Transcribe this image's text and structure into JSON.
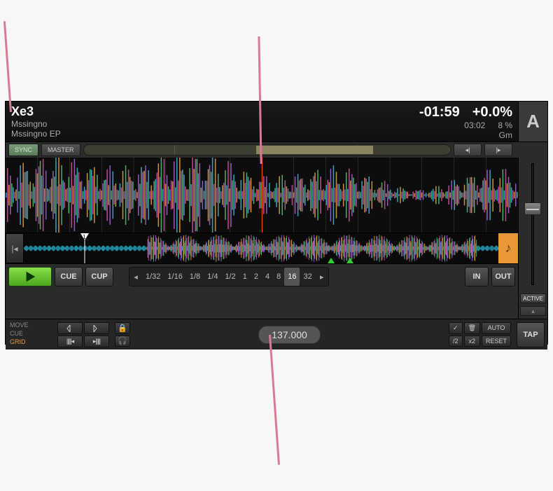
{
  "header": {
    "title": "Xe3",
    "artist": "Mssingno",
    "album": "Mssingno EP",
    "remain": "-01:59",
    "total": "03:02",
    "tempo_offset": "+0.0%",
    "tempo_range": "8 %",
    "key": "Gm",
    "deck": "A"
  },
  "sync": {
    "sync": "SYNC",
    "master": "MASTER"
  },
  "nudge": {
    "back": "◂|",
    "fwd": "|▸"
  },
  "transport": {
    "play": "",
    "cue": "CUE",
    "cup": "CUP"
  },
  "loop": {
    "sizes": [
      "1/32",
      "1/16",
      "1/8",
      "1/4",
      "1/2",
      "1",
      "2",
      "4",
      "8",
      "16",
      "32"
    ],
    "selected": "16",
    "in": "IN",
    "out": "OUT"
  },
  "pitch": {
    "active": "ACTIVE"
  },
  "modes": {
    "move": "MOVE",
    "cue": "CUE",
    "grid": "GRID"
  },
  "grid_tools": {
    "set_left": "",
    "set_right": "",
    "scrub_l": "",
    "scrub_r": ""
  },
  "bpm": "137.000",
  "right": {
    "auto": "AUTO",
    "half": "/2",
    "dbl": "x2",
    "reset": "RESET",
    "tap": "TAP"
  },
  "icons": {
    "lock": "🔒",
    "phones": "🎧",
    "tick": "✓",
    "trash": "🗑",
    "skip": "|◂",
    "note": "♪"
  }
}
